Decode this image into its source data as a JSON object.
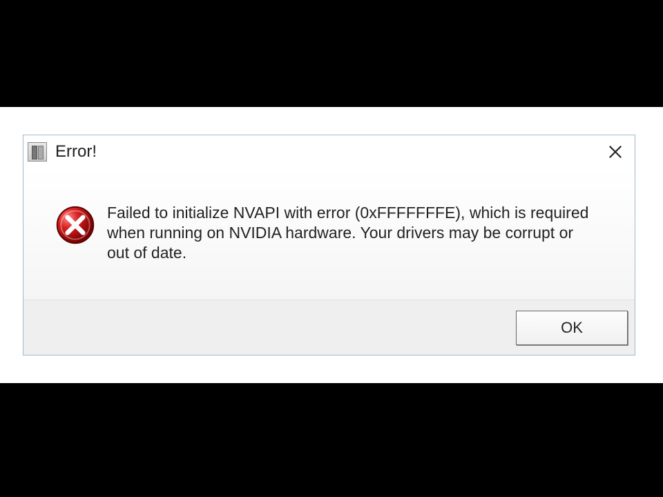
{
  "dialog": {
    "title": "Error!",
    "message": "Failed to initialize NVAPI with error (0xFFFFFFFE), which is required when running on NVIDIA hardware. Your drivers may be corrupt or out of date.",
    "ok_label": "OK"
  }
}
